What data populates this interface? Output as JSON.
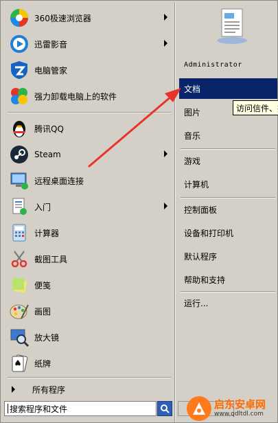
{
  "left_panel": {
    "pinned": [
      {
        "label": "360极速浏览器",
        "icon": "360-browser-icon",
        "submenu": true
      },
      {
        "label": "迅雷影音",
        "icon": "xunlei-player-icon",
        "submenu": true
      },
      {
        "label": "电脑管家",
        "icon": "pc-manager-icon",
        "submenu": false
      },
      {
        "label": "强力卸载电脑上的软件",
        "icon": "uninstaller-icon",
        "submenu": false
      }
    ],
    "recent": [
      {
        "label": "腾讯QQ",
        "icon": "qq-penguin-icon",
        "submenu": false
      },
      {
        "label": "Steam",
        "icon": "steam-icon",
        "submenu": true
      },
      {
        "label": "远程桌面连接",
        "icon": "remote-desktop-icon",
        "submenu": false
      },
      {
        "label": "入门",
        "icon": "getting-started-icon",
        "submenu": true
      },
      {
        "label": "计算器",
        "icon": "calculator-icon",
        "submenu": false
      },
      {
        "label": "截图工具",
        "icon": "snipping-tool-icon",
        "submenu": false
      },
      {
        "label": "便笺",
        "icon": "sticky-notes-icon",
        "submenu": false
      },
      {
        "label": "画图",
        "icon": "paint-icon",
        "submenu": false
      },
      {
        "label": "放大镜",
        "icon": "magnifier-icon",
        "submenu": false
      },
      {
        "label": "纸牌",
        "icon": "solitaire-icon",
        "submenu": false
      }
    ],
    "all_programs": "所有程序",
    "search_placeholder": "搜索程序和文件"
  },
  "right_panel": {
    "user_name": "Administrator",
    "items": [
      {
        "label": "文档",
        "selected": true
      },
      {
        "label": "图片",
        "selected": false
      },
      {
        "label": "音乐",
        "selected": false
      },
      {
        "label": "游戏",
        "selected": false
      },
      {
        "label": "计算机",
        "selected": false
      },
      {
        "label": "控制面板",
        "selected": false
      },
      {
        "label": "设备和打印机",
        "selected": false
      },
      {
        "label": "默认程序",
        "selected": false
      },
      {
        "label": "帮助和支持",
        "selected": false
      },
      {
        "label": "运行...",
        "selected": false
      }
    ]
  },
  "tooltip": "访问信件、报",
  "watermark": {
    "name": "启东安卓网",
    "url": "www.qdltdl.com"
  },
  "colors": {
    "selection": "#0a246a",
    "menu_bg": "#d4d0c8",
    "annotation_arrow": "#e8332a",
    "tooltip_bg": "#ffffe1"
  }
}
